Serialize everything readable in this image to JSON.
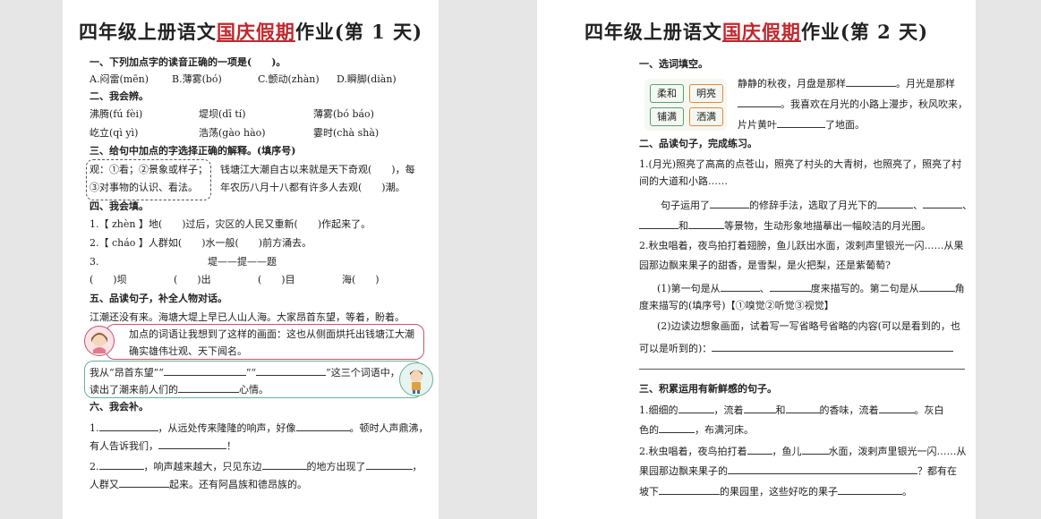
{
  "page1": {
    "title_pre": "四年级上册语文",
    "title_red": "国庆假期",
    "title_post": "作业(第 1 天)",
    "s1_heading": "一、下列加点字的读音正确的一项是(　　)。",
    "s1_options": [
      "A.闷雷(mēn)",
      "B.薄雾(bó)",
      "C.颤动(zhàn)",
      "D.瞬脚(diàn)"
    ],
    "s2_heading": "二、我会辨。",
    "s2_rows": [
      [
        "沸腾(fú fèi)",
        "堤坝(dī tí)",
        "薄雾(bó báo)"
      ],
      [
        "屹立(qì yì)",
        "浩荡(gào hào)",
        "霎时(chà shà)"
      ]
    ],
    "s3_heading": "三、给句中加点的字选择正确的解释。(填序号)",
    "s3_box": [
      "观：①看；②景象或样子；",
      "③对事物的认识、看法。"
    ],
    "s3_sentences": [
      "钱塘江大潮自古以来就是天下奇观(　　)，每",
      "年农历八月十八都有许多人去观(　　)潮。"
    ],
    "s4_heading": "四、我会填。",
    "s4_lines": [
      "1.【 zhèn 】地(　　)过后，灾区的人民又重新(　　)作起来了。",
      "2.【 cháo 】人群如(　　)水一般(　　)前方涌去。"
    ],
    "s4_3_num": "3.",
    "s4_3_center": "堤——提——题",
    "s4_3_items": [
      "(　　)坝",
      "(　　)出",
      "(　　)目",
      "海(　　)"
    ],
    "s5_heading": "五、品读句子，补全人物对话。",
    "s5_text": "江潮还没有来。海塘大堤上早已人山人海。大家昂首东望，等着，盼着。",
    "s5_bubble1": [
      "加点的词语让我想到了这样的画面：这也从侧面烘托出钱塘江大潮",
      "确实雄伟壮观、天下闻名。"
    ],
    "s5_bubble2": [
      "我从“昂首东望”“",
      "”“",
      "”这三个词语中，",
      "读出了潮来前人们的",
      "心情。"
    ],
    "s6_heading": "六、我会补。",
    "s6_l1": [
      "1.",
      "，从远处传来隆隆的响声，好像",
      "。顿时人声鼎沸，"
    ],
    "s6_l2": [
      "有人告诉我们，",
      "！"
    ],
    "s6_l3": [
      "2.",
      "，响声越来越大，只见东边",
      "的地方出现了",
      "，"
    ],
    "s6_l4": [
      "人群又",
      "起来。还有阿昌族和德昂族的。"
    ]
  },
  "page2": {
    "title_pre": "四年级上册语文",
    "title_red": "国庆假期",
    "title_post": "作业(第 2 天)",
    "s1_heading": "一、选词填空。",
    "s1_words": [
      "柔和",
      "明亮",
      "铺满",
      "洒满"
    ],
    "s1_lines": [
      [
        "静静的秋夜，月盘是那样",
        "。月光是那样"
      ],
      [
        "",
        "。我喜欢在月光的小路上漫步，秋风吹来，"
      ],
      [
        "片片黄叶",
        "了地面。"
      ]
    ],
    "s2_heading": "二、品读句子，完成练习。",
    "s2_p1": [
      "1.(月光)照亮了高高的点苍山，照亮了村头的大青树，也照亮了，照亮了村",
      "间的大道和小路……"
    ],
    "s2_q1a": [
      "句子运用了",
      "的修辞手法，选取了月光下的",
      "、",
      "、"
    ],
    "s2_q1b": [
      "和",
      "等景物，生动形象地描摹出一幅皎洁的月光图。"
    ],
    "s2_p2": [
      "2.秋虫唱着，夜鸟拍打着翅膀，鱼儿跃出水面，泼剌声里银光一闪……从果",
      "园那边飘来果子的甜香，是雪梨，是火把梨，还是紫葡萄?"
    ],
    "s2_q2a": [
      "(1)第一句是从",
      "、",
      "度来描写的。第二句是从",
      "角"
    ],
    "s2_q2b": "度来描写的(填序号)【①嗅觉②听觉③视觉】",
    "s2_q2c": "(2)边读边想象画面，试着写一写省略号省略的内容(可以是看到的，也",
    "s2_q2d": "可以是听到的)：",
    "s3_heading": "三、积累运用有新鲜感的句子。",
    "s3_l1": [
      "1.细细的",
      "，流着",
      "和",
      "的香味，流着",
      "。灰白"
    ],
    "s3_l2": [
      "色的",
      "，布满河床。"
    ],
    "s3_l3": [
      "2.秋虫唱着，夜鸟拍打着",
      "，鱼儿",
      "水面，泼剌声里银光一闪……从"
    ],
    "s3_l4": [
      "果园那边飘来果子的",
      "？都有在"
    ],
    "s3_l5": [
      "坡下",
      "的果园里，这些好吃的果子",
      "。"
    ]
  },
  "colors": {
    "accent_red": "#c0282d",
    "bubble_red": "#c8556a",
    "bubble_green": "#6bb09a",
    "word_green": "#5aa06e",
    "word_orange": "#e08a3c"
  }
}
